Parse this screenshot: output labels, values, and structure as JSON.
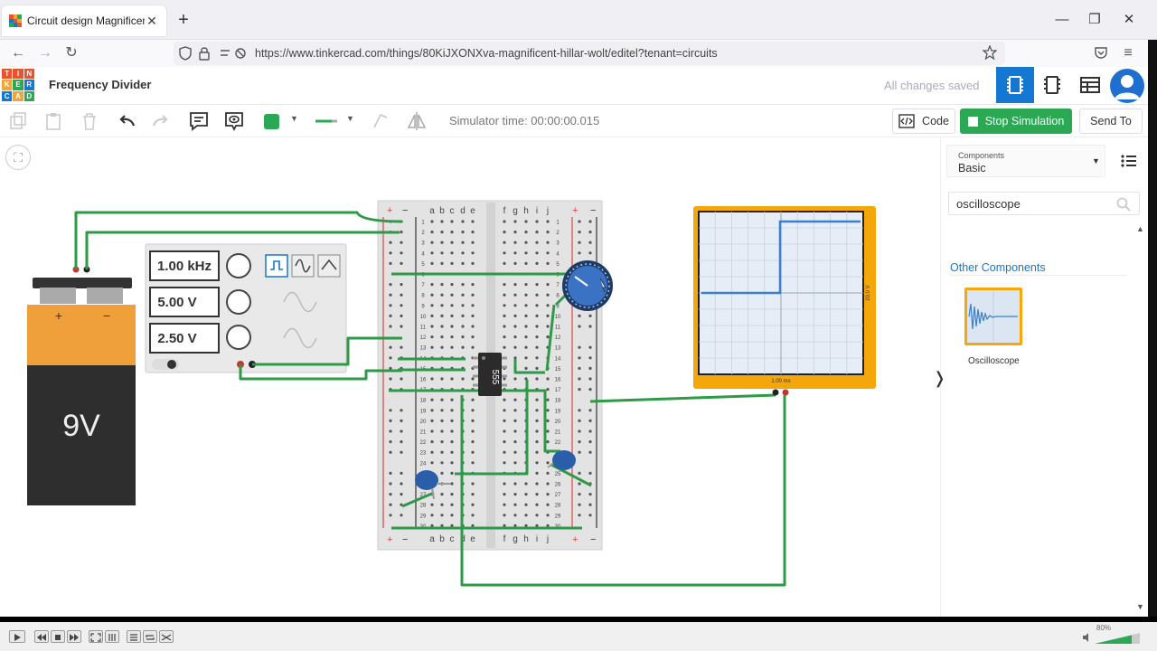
{
  "browser": {
    "tab_title": "Circuit design Magnificent Hilla",
    "tab_close": "✕",
    "new_tab": "+",
    "url": "https://www.tinkercad.com/things/80KiJXONXva-magnificent-hillar-wolt/editel?tenant=circuits",
    "win_min": "—",
    "win_max": "❐",
    "win_close": "✕"
  },
  "app": {
    "logo_letters": [
      "T",
      "I",
      "N",
      "K",
      "E",
      "R",
      "C",
      "A",
      "D"
    ],
    "logo_colors": [
      "#e8542e",
      "#e8542e",
      "#e8542e",
      "#f0a43a",
      "#2aa854",
      "#1477d1",
      "#1477d1",
      "#f0a43a",
      "#2aa854"
    ],
    "project_title": "Frequency Divider",
    "save_status": "All changes saved"
  },
  "toolbar": {
    "sim_time": "Simulator time: 00:00:00.015",
    "code_label": "Code",
    "stop_label": "Stop Simulation",
    "send_label": "Send To",
    "color_swatch": "#2aa854"
  },
  "canvas": {
    "fit_icon": "⛶"
  },
  "components": {
    "battery": {
      "label": "9V",
      "plus": "+",
      "minus": "−"
    },
    "function_generator": {
      "frequency": "1.00 kHz",
      "amplitude": "5.00 V",
      "offset": "2.50 V"
    },
    "breadboard": {
      "top_cols_left": [
        "a",
        "b",
        "c",
        "d",
        "e"
      ],
      "top_cols_right": [
        "f",
        "g",
        "h",
        "i",
        "j"
      ],
      "rail_plus": "+",
      "rail_minus": "−",
      "row_numbers": [
        "1",
        "2",
        "3",
        "4",
        "5",
        "6",
        "7",
        "8",
        "9",
        "10",
        "11",
        "12",
        "13",
        "14",
        "15",
        "16",
        "17",
        "18",
        "19",
        "20",
        "21",
        "22",
        "23",
        "24",
        "25",
        "26",
        "27",
        "28",
        "29",
        "30"
      ]
    },
    "ic": {
      "label": "555"
    },
    "oscilloscope": {
      "volt_label": "20.0 V",
      "time_label": "1.00 ms"
    }
  },
  "panel": {
    "select_caption": "Components",
    "select_value": "Basic",
    "search_value": "oscilloscope",
    "other_heading": "Other Components",
    "result_label": "Oscilloscope",
    "collapse_glyph": "❭"
  },
  "player": {
    "volume": "80%"
  }
}
